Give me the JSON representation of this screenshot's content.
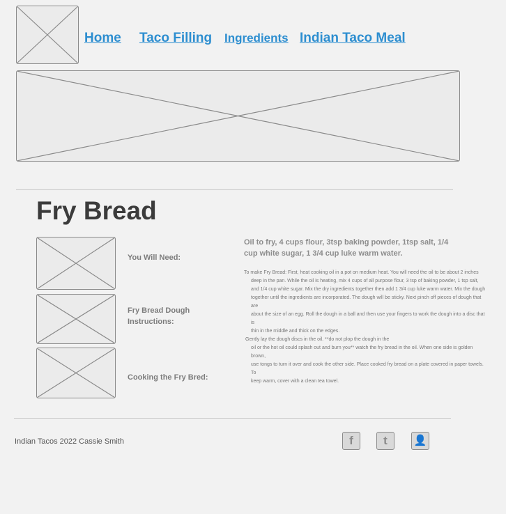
{
  "nav": {
    "logo_icon": "image-placeholder-icon",
    "items": [
      {
        "label": "Home"
      },
      {
        "label": "Taco Filling"
      },
      {
        "label": "Ingredients"
      },
      {
        "label": "Indian Taco Meal"
      }
    ],
    "link_color": "#2d8ed0"
  },
  "page": {
    "title": "Fry Bread",
    "sections": [
      {
        "label": "You Will Need:"
      },
      {
        "label": "Fry Bread Dough Instructions:"
      },
      {
        "label": "Cooking the Fry Bred:"
      }
    ],
    "summary": "Oil to fry, 4 cups flour, 3tsp baking powder, 1tsp salt, 1/4 cup white sugar, 1 3/4 cup luke warm water.",
    "instructions": [
      "To make Fry Bread: First, heat cooking oil in a pot on medium heat. You will need the oil to be about 2 inches",
      "deep in the pan. While the oil is heating, mix 4 cups of all purpose flour, 3 tsp of baking powder, 1 tsp salt,",
      "and 1/4 cup white sugar. Mix the dry ingredients together then add 1 3/4 cup luke warm water. Mix the dough",
      "together until the ingredients are incorporated. The dough will be sticky. Next pinch off pieces of dough that are",
      "about the size of an egg. Roll the dough in a ball and then use your fingers to work the dough into a disc that is",
      "thin in the middle and thick on the edges.",
      "Gently lay the dough discs in the oil. **do not plop the dough in the",
      "oil or the hot oil could splash out and burn you** watch the fry bread in the oil. When one side is golden brown,",
      "use tongs to turn it over and cook the other side. Place cooked fry bread on a plate covered in paper towels. To",
      "keep warm, cover with a clean tea towel."
    ]
  },
  "footer": {
    "text": "Indian Tacos 2022 Cassie Smith",
    "social": [
      {
        "icon": "facebook-icon",
        "glyph": "f"
      },
      {
        "icon": "twitter-icon",
        "glyph": "t"
      },
      {
        "icon": "user-icon",
        "glyph": "👤"
      }
    ]
  }
}
